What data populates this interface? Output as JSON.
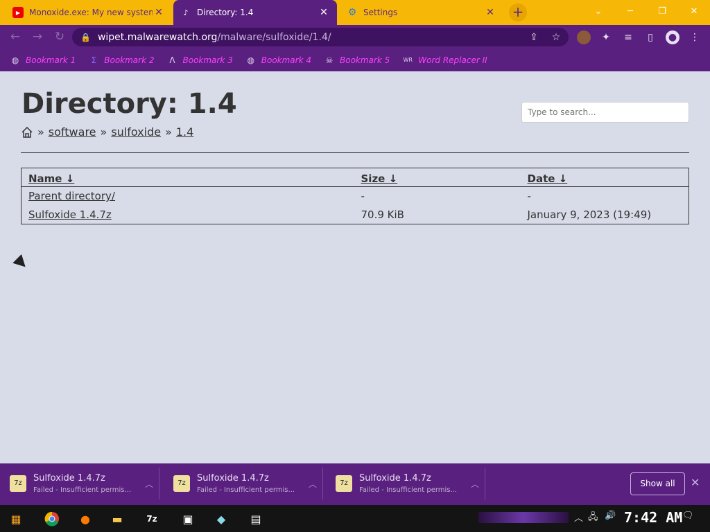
{
  "tabs": [
    {
      "icon": "youtube-icon",
      "label": "Monoxide.exe: My new system",
      "active": false
    },
    {
      "icon": "music-note-icon",
      "label": "Directory: 1.4",
      "active": true
    },
    {
      "icon": "gear-icon",
      "label": "Settings",
      "active": false
    }
  ],
  "address": {
    "domain": "wipet.malwarewatch.org",
    "path": "/malware/sulfoxide/1.4/"
  },
  "bookmarks": [
    {
      "icon": "globe-icon",
      "label": "Bookmark 1"
    },
    {
      "icon": "bracket-icon",
      "label": "Bookmark 2"
    },
    {
      "icon": "triangle-icon",
      "label": "Bookmark 3"
    },
    {
      "icon": "globe-icon",
      "label": "Bookmark 4"
    },
    {
      "icon": "skull-icon",
      "label": "Bookmark 5"
    },
    {
      "icon": "wr-icon",
      "label": "Word Replacer II"
    }
  ],
  "page": {
    "title": "Directory: 1.4",
    "search_placeholder": "Type to search...",
    "breadcrumbs": [
      "software",
      "sulfoxide",
      "1.4"
    ],
    "table": {
      "headers": [
        "Name ↓",
        "Size ↓",
        "Date ↓"
      ],
      "rows": [
        [
          "Parent directory/",
          "-",
          "-"
        ],
        [
          "Sulfoxide 1.4.7z",
          "70.9 KiB",
          "January 9, 2023 (19:49)"
        ]
      ]
    }
  },
  "downloads": [
    {
      "name": "Sulfoxide 1.4.7z",
      "status": "Failed - Insufficient permis..."
    },
    {
      "name": "Sulfoxide 1.4.7z",
      "status": "Failed - Insufficient permis..."
    },
    {
      "name": "Sulfoxide 1.4.7z",
      "status": "Failed - Insufficient permis..."
    }
  ],
  "download_bar": {
    "show_all": "Show all"
  },
  "taskbar": {
    "clock": "7:42 AM",
    "apps": [
      "start-icon",
      "chrome-icon",
      "firefox-icon",
      "file-explorer-icon",
      "7zip-icon",
      "app-icon",
      "app-icon",
      "app-icon"
    ]
  },
  "colors": {
    "accent": "#5a2080",
    "tab_bar": "#f7b707",
    "bookmark_text": "#ff40ff",
    "page_bg": "#d8dce8"
  }
}
